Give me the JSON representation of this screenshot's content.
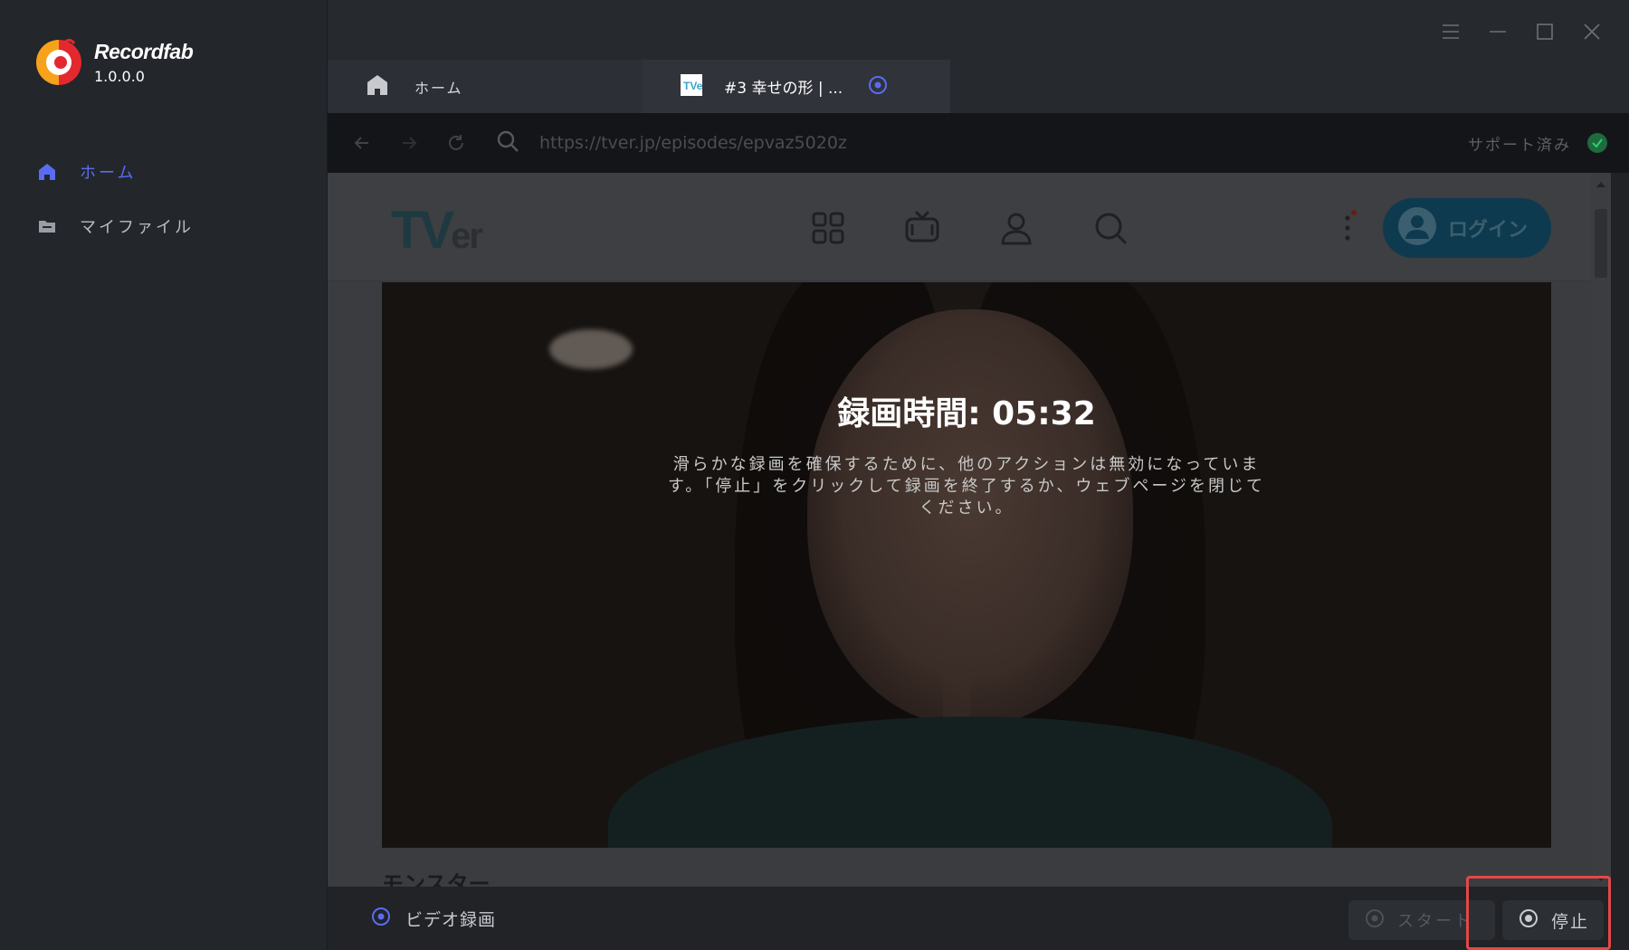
{
  "app": {
    "name": "Recordfab",
    "version": "1.0.0.0"
  },
  "colors": {
    "accent": "#5a6cf0",
    "highlight": "#e34848",
    "support_ok": "#1e6b3e"
  },
  "sidebar": {
    "items": [
      {
        "label": "ホーム",
        "icon": "home-icon",
        "active": true
      },
      {
        "label": "マイファイル",
        "icon": "folder-icon",
        "active": false
      }
    ]
  },
  "window": {
    "controls": [
      "menu-icon",
      "minimize-icon",
      "maximize-icon",
      "close-icon"
    ]
  },
  "tabs": [
    {
      "label": "ホーム",
      "icon": "home-icon"
    },
    {
      "label": "#3 幸せの形 | ...",
      "icon": "tver-favicon",
      "recording": true
    }
  ],
  "address": {
    "url": "https://tver.jp/episodes/epvaz5020z",
    "support_label": "サポート済み"
  },
  "tver": {
    "logo_tv": "TV",
    "logo_er": "er",
    "login_label": "ログイン",
    "below_title": "モンスター"
  },
  "recording": {
    "time_label": "録画時間: 05:32",
    "message": "滑らかな録画を確保するために、他のアクションは無効になっています。「停止」をクリックして録画を終了するか、ウェブページを閉じてください。"
  },
  "bottom": {
    "mode_label": "ビデオ録画",
    "start_label": "スタート",
    "stop_label": "停止"
  }
}
